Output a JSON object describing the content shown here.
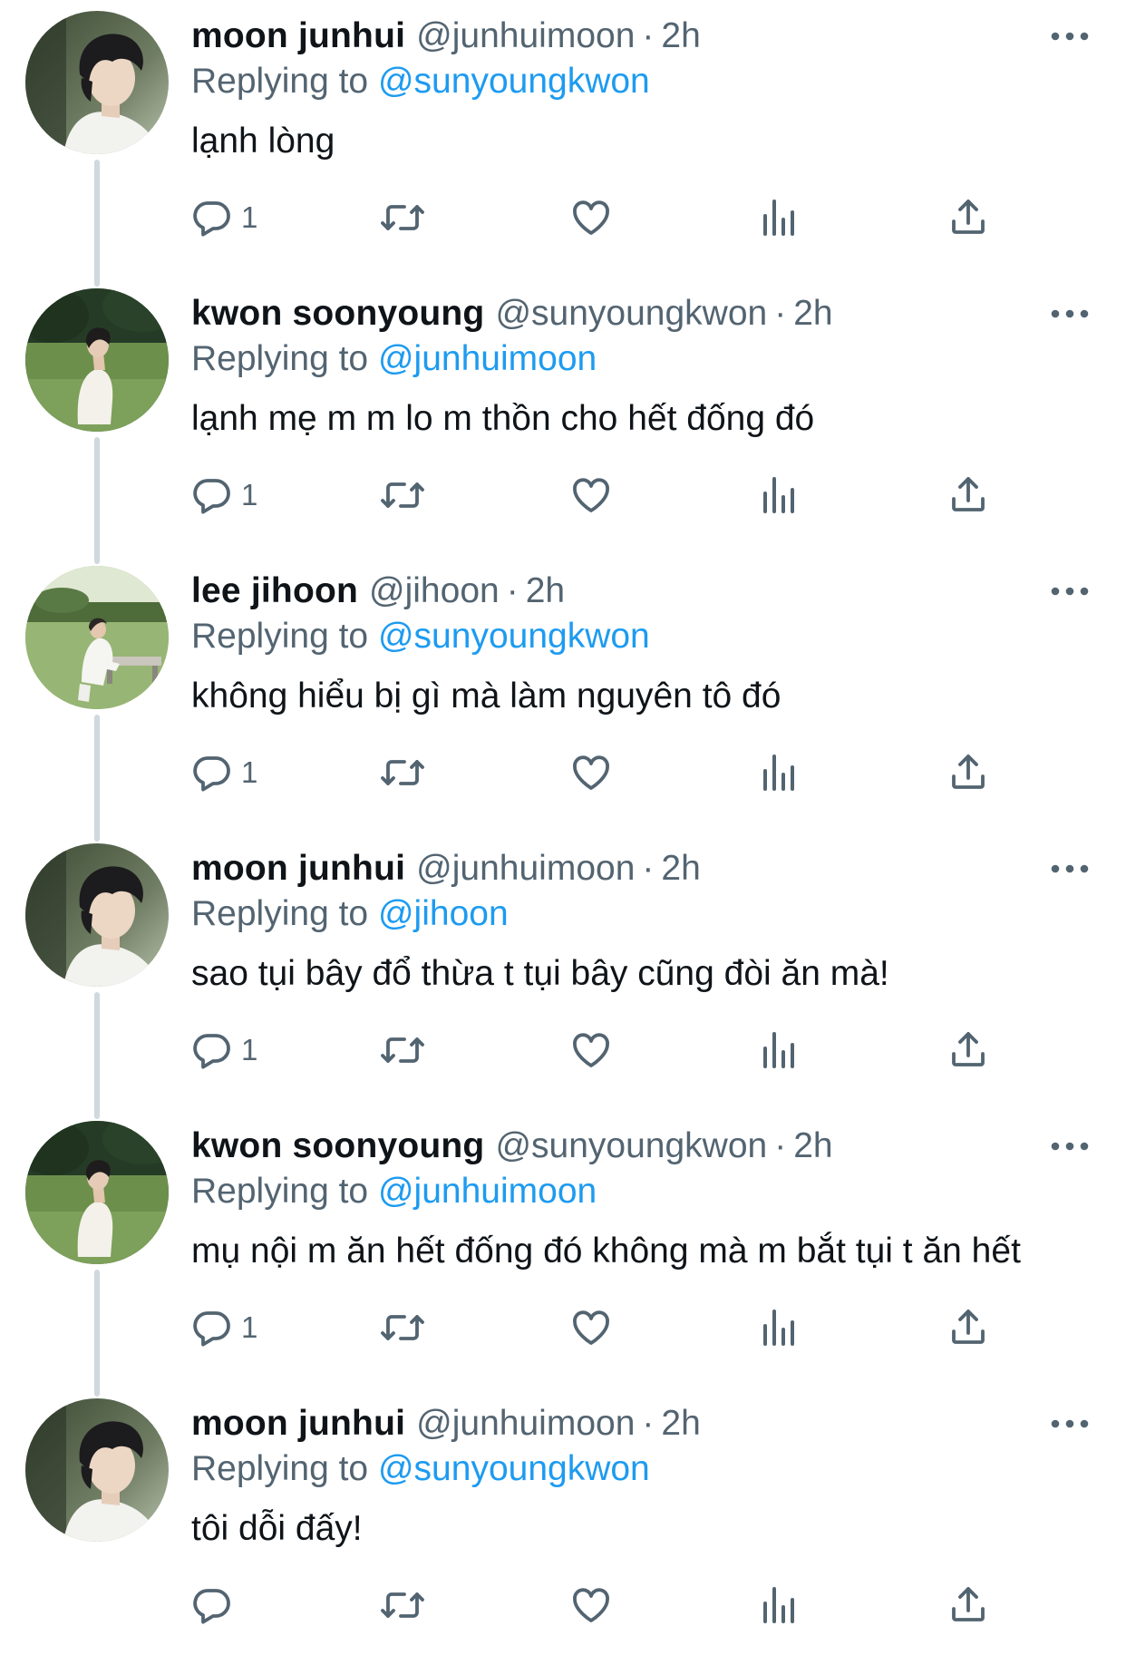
{
  "tweets": [
    {
      "name": "moon junhui",
      "handle": "@junhuimoon",
      "dot": "·",
      "time": "2h",
      "replying_label": "Replying to",
      "replying_to": "@sunyoungkwon",
      "text": "lạnh lòng",
      "reply_count": "1",
      "avatar": "avatar-portrait-profile"
    },
    {
      "name": "kwon soonyoung",
      "handle": "@sunyoungkwon",
      "dot": "·",
      "time": "2h",
      "replying_label": "Replying to",
      "replying_to": "@junhuimoon",
      "text": "lạnh mẹ m m lo m thồn cho hết đống đó",
      "reply_count": "1",
      "avatar": "avatar-field-sitting"
    },
    {
      "name": "lee jihoon",
      "handle": "@jihoon",
      "dot": "·",
      "time": "2h",
      "replying_label": "Replying to",
      "replying_to": "@sunyoungkwon",
      "text": "không hiểu bị gì mà làm nguyên tô đó",
      "reply_count": "1",
      "avatar": "avatar-bench-park"
    },
    {
      "name": "moon junhui",
      "handle": "@junhuimoon",
      "dot": "·",
      "time": "2h",
      "replying_label": "Replying to",
      "replying_to": "@jihoon",
      "text": "sao tụi bây đổ thừa t tụi bây cũng đòi ăn mà!",
      "reply_count": "1",
      "avatar": "avatar-portrait-profile"
    },
    {
      "name": "kwon soonyoung",
      "handle": "@sunyoungkwon",
      "dot": "·",
      "time": "2h",
      "replying_label": "Replying to",
      "replying_to": "@junhuimoon",
      "text": "mụ nội m ăn hết đống đó không mà m bắt tụi t ăn hết",
      "reply_count": "1",
      "avatar": "avatar-field-sitting"
    },
    {
      "name": "moon junhui",
      "handle": "@junhuimoon",
      "dot": "·",
      "time": "2h",
      "replying_label": "Replying to",
      "replying_to": "@sunyoungkwon",
      "text": "tôi dỗi đấy!",
      "reply_count": "",
      "avatar": "avatar-portrait-profile"
    }
  ],
  "icons": {
    "more": "more-horizontal-icon",
    "reply": "reply-bubble-icon",
    "retweet": "retweet-icon",
    "like": "heart-icon",
    "views": "bar-chart-icon",
    "share": "share-upload-icon"
  },
  "colors": {
    "text": "#0f1419",
    "secondary": "#536471",
    "link": "#1d9bf0",
    "thread_line": "#cfd9de"
  }
}
